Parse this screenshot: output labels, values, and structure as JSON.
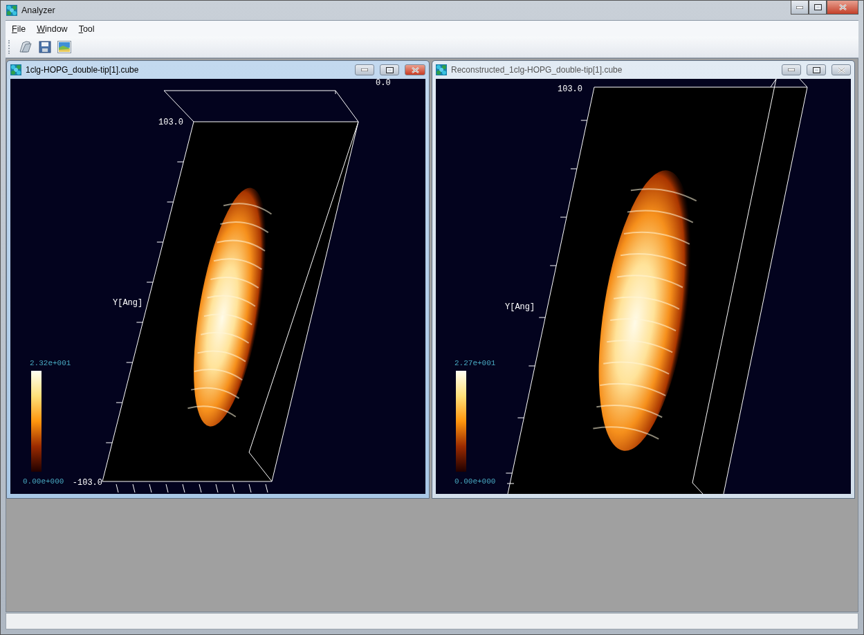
{
  "window": {
    "title": "Analyzer"
  },
  "menu": [
    {
      "label": "File",
      "first_letter_underlined": true
    },
    {
      "label": "Window",
      "first_letter_underlined": true
    },
    {
      "label": "Tool",
      "first_letter_underlined": true
    }
  ],
  "toolbar": [
    {
      "kind": "open"
    },
    {
      "kind": "save"
    },
    {
      "kind": "image"
    }
  ],
  "documents": [
    {
      "title": "1clg-HOPG_double-tip[1].cube",
      "active": true,
      "plot": {
        "top_value": "0.0",
        "corner_value": "103.0",
        "axis_title": "Y[Ang]",
        "bottom_value": "-103.0",
        "scale_max": "2.32e+001",
        "scale_min": "0.00e+000"
      }
    },
    {
      "title": "Reconstructed_1clg-HOPG_double-tip[1].cube",
      "active": false,
      "plot": {
        "corner_value": "103.0",
        "axis_title": "Y[Ang]",
        "scale_max": "2.27e+001",
        "scale_min": "0.00e+000"
      }
    }
  ]
}
